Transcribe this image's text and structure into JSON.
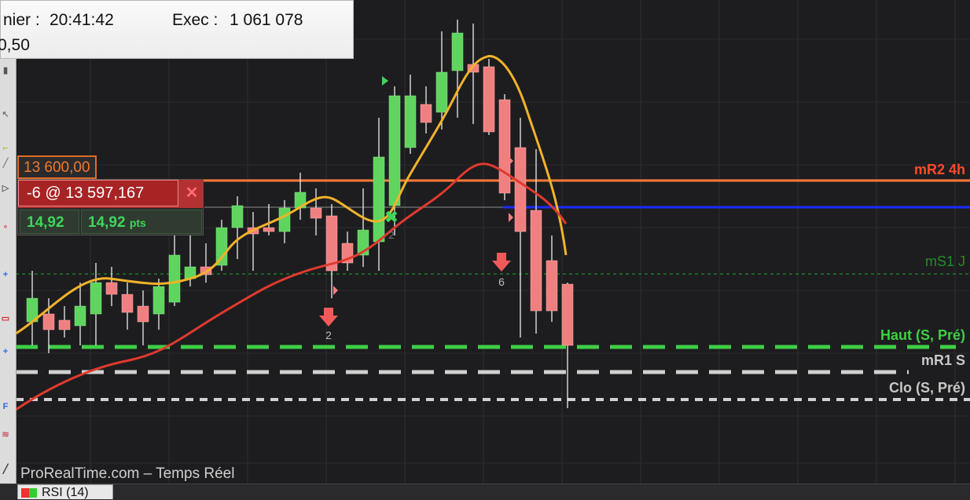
{
  "info_panel": {
    "line1_label": "nier :",
    "line1_time": "20:41:42",
    "line1_exec_label": "Exec :",
    "line1_exec_value": "1 061 078",
    "line2_value": "0,50"
  },
  "price_tag": "13 600,00",
  "order_ticket": {
    "label": "-6 @ 13 597,167",
    "close_symbol": "✕",
    "pnl_points": "14,92",
    "pnl_value": "14,92",
    "pnl_unit": "pts"
  },
  "levels": {
    "mr2": {
      "label": "mR2 4h",
      "color": "#ff7a3a"
    },
    "blue": {
      "color": "#1a2bff"
    },
    "ms1": {
      "label": "mS1 J",
      "color": "#1f8f2a"
    },
    "haut": {
      "label": "Haut (S, Pré)",
      "color": "#3fcf46"
    },
    "mr1": {
      "label": "mR1 S",
      "color": "#d0d0d0"
    },
    "clo": {
      "label": "Clo (S, Pré)",
      "color": "#d0d0d0"
    }
  },
  "markers": {
    "down_2": "2",
    "down_6": "6",
    "cross_2": "2"
  },
  "watermark": "ProRealTime.com – Temps Réel",
  "bottom_tab": "RSI (14)",
  "colors": {
    "up_candle": "#5fd45f",
    "down_candle": "#f08080",
    "ma_fast": "#f2b32a",
    "ma_slow": "#e03a2e"
  },
  "toolbar_icons": [
    "cursor-icon",
    "pointer-arrow-icon",
    "line-tool-icon",
    "trendline-icon",
    "arrow-right-icon",
    "ray-icon",
    "plus-marker-icon",
    "rectangle-tool-icon",
    "plus-icon",
    "fibonacci-icon",
    "channel-icon",
    "pencil-icon"
  ]
}
